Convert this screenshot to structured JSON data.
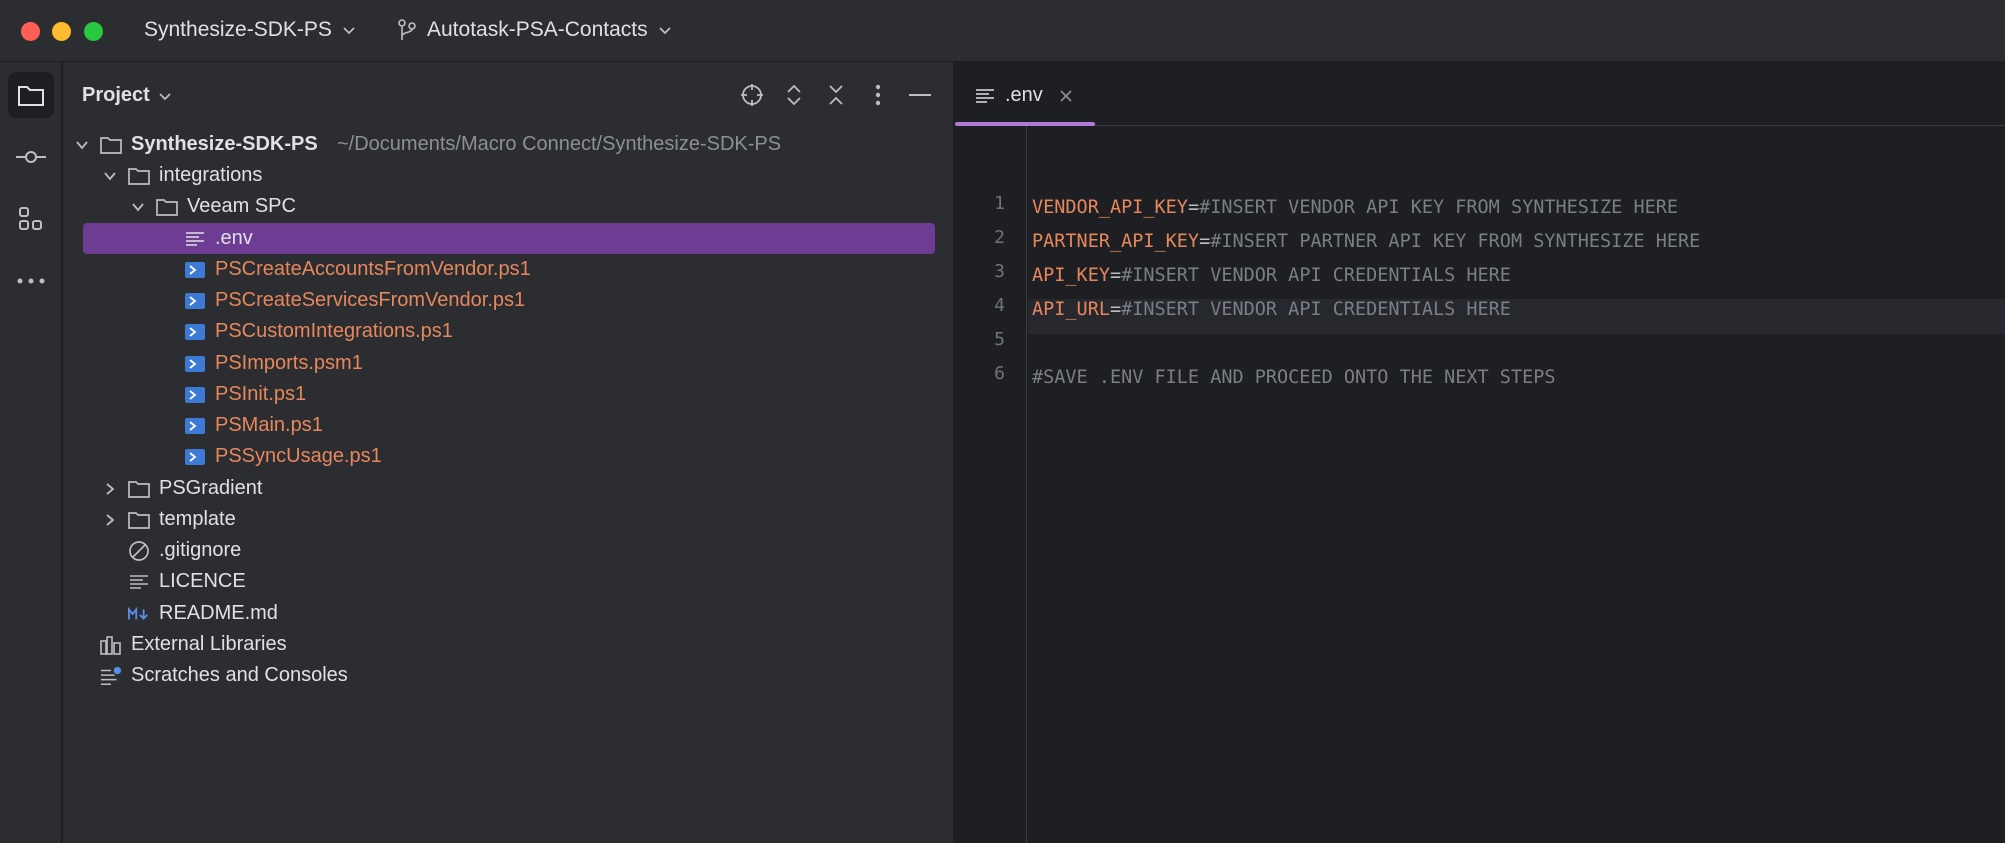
{
  "titlebar": {
    "project_name": "Synthesize-SDK-PS",
    "branch_name": "Autotask-PSA-Contacts"
  },
  "toolstrip": {
    "items": [
      "folder-icon",
      "commit-icon",
      "structure-icon",
      "more-icon"
    ]
  },
  "project_panel": {
    "title": "Project",
    "actions": [
      "locate-icon",
      "expand-all-icon",
      "collapse-all-icon",
      "options-icon",
      "hide-icon"
    ],
    "tree": {
      "root": {
        "label": "Synthesize-SDK-PS",
        "path": "~/Documents/Macro Connect/Synthesize-SDK-PS"
      },
      "integrations": "integrations",
      "veeam": "Veeam SPC",
      "env": ".env",
      "files": [
        "PSCreateAccountsFromVendor.ps1",
        "PSCreateServicesFromVendor.ps1",
        "PSCustomIntegrations.ps1",
        "PSImports.psm1",
        "PSInit.ps1",
        "PSMain.ps1",
        "PSSyncUsage.ps1"
      ],
      "psgradient": "PSGradient",
      "template": "template",
      "gitignore": ".gitignore",
      "licence": "LICENCE",
      "readme": "README.md",
      "external_libraries": "External Libraries",
      "scratches": "Scratches and Consoles"
    }
  },
  "editor": {
    "tab_label": ".env",
    "lines": [
      {
        "num": "1",
        "key": "VENDOR_API_KEY",
        "eq": "=",
        "value": "#INSERT VENDOR API KEY FROM SYNTHESIZE HERE"
      },
      {
        "num": "2",
        "key": "PARTNER_API_KEY",
        "eq": "=",
        "value": "#INSERT PARTNER API KEY FROM SYNTHESIZE HERE"
      },
      {
        "num": "3",
        "key": "API_KEY",
        "eq": "=",
        "value": "#INSERT VENDOR API CREDENTIALS HERE"
      },
      {
        "num": "4",
        "key": "API_URL",
        "eq": "=",
        "value": "#INSERT VENDOR API CREDENTIALS HERE"
      },
      {
        "num": "5",
        "key": "",
        "eq": "",
        "value": ""
      },
      {
        "num": "6",
        "key": "",
        "eq": "",
        "value": "#SAVE .ENV FILE AND PROCEED ONTO THE NEXT STEPS"
      }
    ]
  },
  "colors": {
    "selection": "#6e3c93",
    "accent_underline": "#b07ad8",
    "untracked_file": "#e6875c"
  }
}
